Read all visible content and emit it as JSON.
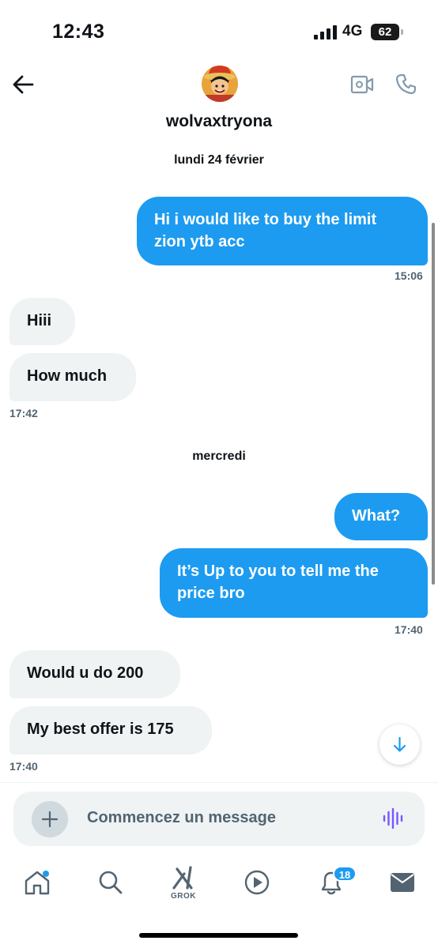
{
  "status_bar": {
    "time": "12:43",
    "network": "4G",
    "battery": "62"
  },
  "header": {
    "contact_name": "wolvaxtryona",
    "icons": [
      "back-arrow-icon",
      "video-call-icon",
      "phone-icon"
    ]
  },
  "conversation": {
    "date_separators": [
      "lundi 24 février",
      "mercredi"
    ],
    "messages": [
      {
        "direction": "outgoing",
        "text": "Hi i would like to buy the limit zion ytb acc"
      },
      {
        "direction": "outgoing",
        "time": "15:06"
      },
      {
        "direction": "incoming",
        "text": "Hiii"
      },
      {
        "direction": "incoming",
        "text": "How much"
      },
      {
        "direction": "incoming",
        "time": "17:42"
      },
      {
        "direction": "outgoing",
        "text": "What?"
      },
      {
        "direction": "outgoing",
        "text": "It’s Up to you to tell me the price bro"
      },
      {
        "direction": "outgoing",
        "time": "17:40"
      },
      {
        "direction": "incoming",
        "text": "Would u do 200"
      },
      {
        "direction": "incoming",
        "text": "My best offer is 175"
      },
      {
        "direction": "incoming",
        "time": "17:40"
      }
    ]
  },
  "composer": {
    "placeholder": "Commencez un message"
  },
  "tab_bar": {
    "grok_label": "GROK",
    "notifications_badge": "18",
    "tabs": [
      "home-icon",
      "search-icon",
      "grok-icon",
      "video-icon",
      "notifications-icon",
      "messages-icon"
    ]
  },
  "colors": {
    "accent": "#1d9bf0",
    "incoming_bubble": "#eff3f4",
    "secondary_text": "#536471",
    "voice_icon": "#7856ff"
  }
}
